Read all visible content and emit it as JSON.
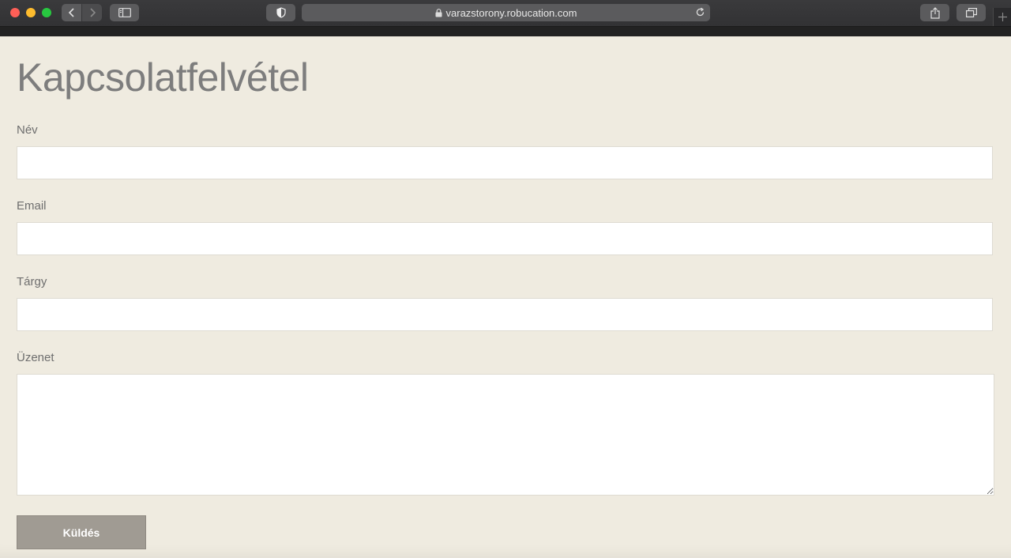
{
  "browser": {
    "url": "varazstorony.robucation.com"
  },
  "page": {
    "title": "Kapcsolatfelvétel"
  },
  "form": {
    "name_label": "Név",
    "name_value": "",
    "email_label": "Email",
    "email_value": "",
    "subject_label": "Tárgy",
    "subject_value": "",
    "message_label": "Üzenet",
    "message_value": "",
    "submit_label": "Küldés"
  },
  "colors": {
    "page_background": "#efebe0",
    "title": "#7d7d7d",
    "button": "#a09b93"
  },
  "icons": [
    "back-chevron-icon",
    "forward-chevron-icon",
    "sidebar-icon",
    "shield-icon",
    "lock-icon",
    "reload-icon",
    "share-icon",
    "tabs-overview-icon",
    "plus-icon"
  ]
}
